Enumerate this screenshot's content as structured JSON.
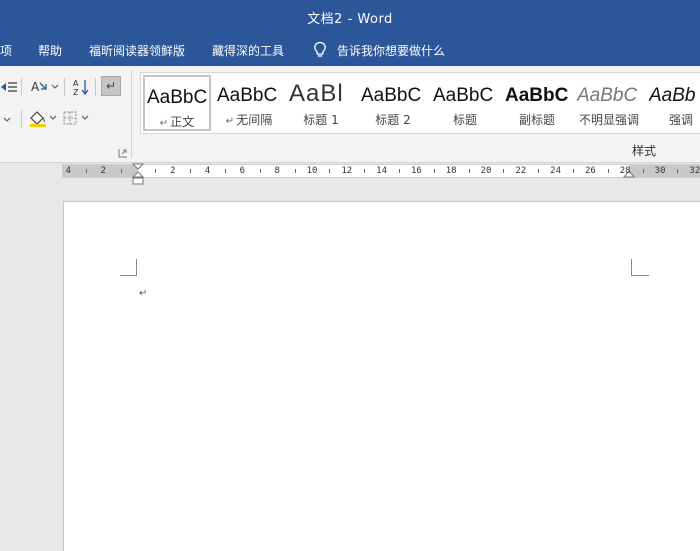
{
  "window": {
    "title": "文档2  -  Word"
  },
  "menu": {
    "items": [
      {
        "label": "项"
      },
      {
        "label": "帮助"
      },
      {
        "label": "福昕阅读器领鲜版"
      },
      {
        "label": "藏得深的工具"
      }
    ],
    "tell_me": "告诉我你想要做什么"
  },
  "ribbon": {
    "paragraph_group_buttons": [
      "line-spacing",
      "text-direction",
      "sort",
      "show-marks",
      "shading",
      "borders"
    ],
    "styles_group_label": "样式",
    "styles": [
      {
        "preview": "AaBbC",
        "name": "正文",
        "selected": true,
        "has_return": true
      },
      {
        "preview": "AaBbC",
        "name": "无间隔",
        "selected": false,
        "has_return": true
      },
      {
        "preview": "AaBl",
        "name": "标题 1",
        "selected": false,
        "has_return": false
      },
      {
        "preview": "AaBbC",
        "name": "标题 2",
        "selected": false,
        "has_return": false
      },
      {
        "preview": "AaBbC",
        "name": "标题",
        "selected": false,
        "has_return": false
      },
      {
        "preview": "AaBbC",
        "name": "副标题",
        "selected": false,
        "has_return": false
      },
      {
        "preview": "AaBbC",
        "name": "不明显强调",
        "selected": false,
        "has_return": false
      },
      {
        "preview": "AaBb",
        "name": "强调",
        "selected": false,
        "has_return": false
      }
    ]
  },
  "ruler": {
    "labels": [
      "4",
      "2",
      "2",
      "4",
      "6",
      "8",
      "10",
      "12",
      "14",
      "16",
      "18",
      "20",
      "22",
      "24",
      "26",
      "28",
      "30",
      "32"
    ]
  },
  "document": {
    "paragraph_mark": "↵"
  },
  "colors": {
    "titlebar": "#2b579a",
    "ribbon": "#f3f3f3",
    "page": "#ffffff",
    "workspace": "#e8e8e8"
  }
}
